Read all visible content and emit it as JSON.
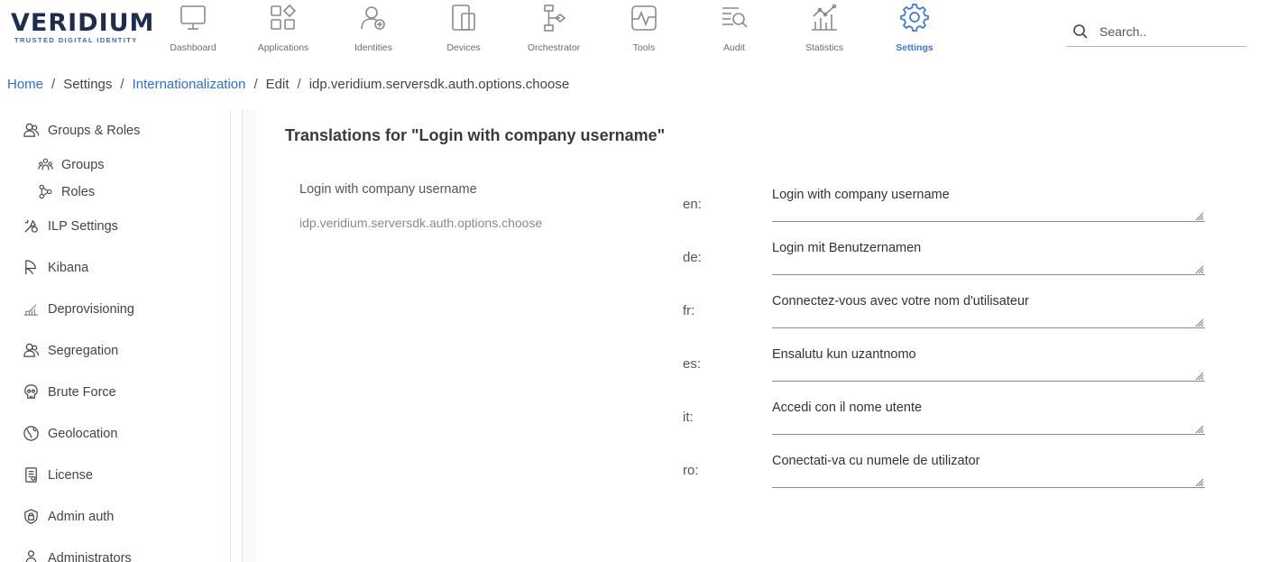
{
  "logo": {
    "name": "VERIDIUM",
    "tagline": "TRUSTED DIGITAL IDENTITY"
  },
  "nav": [
    {
      "label": "Dashboard",
      "icon": "monitor-icon"
    },
    {
      "label": "Applications",
      "icon": "applications-grid-icon"
    },
    {
      "label": "Identities",
      "icon": "identities-user-icon"
    },
    {
      "label": "Devices",
      "icon": "devices-icon"
    },
    {
      "label": "Orchestrator",
      "icon": "orchestrator-icon"
    },
    {
      "label": "Tools",
      "icon": "tools-pulse-icon"
    },
    {
      "label": "Audit",
      "icon": "audit-search-icon"
    },
    {
      "label": "Statistics",
      "icon": "statistics-chart-icon"
    },
    {
      "label": "Settings",
      "icon": "gear-icon",
      "active": true
    }
  ],
  "search": {
    "placeholder": "Search.."
  },
  "breadcrumb": {
    "home": "Home",
    "settings": "Settings",
    "internationalization": "Internationalization",
    "edit": "Edit",
    "key": "idp.veridium.serversdk.auth.options.choose",
    "separator": "/"
  },
  "sidebar": {
    "items": [
      {
        "label": "Groups & Roles",
        "icon": "groups-roles-icon"
      },
      {
        "label": "Groups",
        "icon": "groups-icon",
        "sub": true
      },
      {
        "label": "Roles",
        "icon": "roles-icon",
        "sub": true
      },
      {
        "label": "ILP Settings",
        "icon": "ilp-settings-icon"
      },
      {
        "label": "Kibana",
        "icon": "kibana-icon"
      },
      {
        "label": "Deprovisioning",
        "icon": "deprovisioning-icon"
      },
      {
        "label": "Segregation",
        "icon": "segregation-icon"
      },
      {
        "label": "Brute Force",
        "icon": "skull-icon"
      },
      {
        "label": "Geolocation",
        "icon": "globe-icon"
      },
      {
        "label": "License",
        "icon": "license-icon"
      },
      {
        "label": "Admin auth",
        "icon": "shield-lock-icon"
      },
      {
        "label": "Administrators",
        "icon": "administrators-icon"
      }
    ]
  },
  "main": {
    "title": "Translations for \"Login with company username\"",
    "message_text": "Login with company username",
    "message_key": "idp.veridium.serversdk.auth.options.choose",
    "translations": [
      {
        "lang": "en:",
        "value": "Login with company username"
      },
      {
        "lang": "de:",
        "value": "Login mit Benutzernamen"
      },
      {
        "lang": "fr:",
        "value": "Connectez-vous avec votre nom d'utilisateur"
      },
      {
        "lang": "es:",
        "value": "Ensalutu kun uzantnomo"
      },
      {
        "lang": "it:",
        "value": "Accedi con il nome utente"
      },
      {
        "lang": "ro:",
        "value": "Conectati-va cu numele de utilizator"
      }
    ]
  },
  "colors": {
    "accent": "#3a78d8",
    "link": "#2a6fd6",
    "logo": "#1e2d4d",
    "icon": "#8a8a8a"
  }
}
